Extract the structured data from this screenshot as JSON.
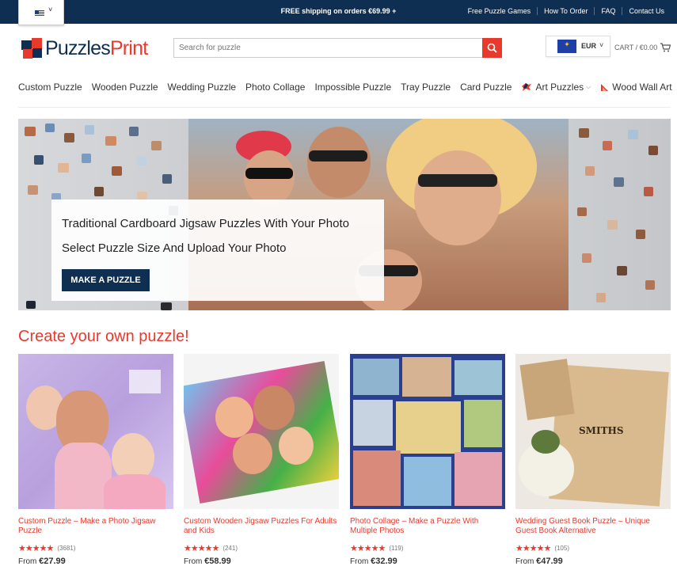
{
  "topbar": {
    "shipping": "FREE shipping on orders €69.99 +",
    "links": [
      "Free Puzzle Games",
      "How To Order",
      "FAQ",
      "Contact Us"
    ]
  },
  "language": {
    "icon": "us-flag-icon"
  },
  "logo": {
    "part1": "Puzzles",
    "part2": "Print"
  },
  "search": {
    "placeholder": "Search for puzzle"
  },
  "currency": {
    "label": "EUR"
  },
  "cart": {
    "label": "CART / €0.00"
  },
  "nav": [
    "Custom Puzzle",
    "Wooden Puzzle",
    "Wedding Puzzle",
    "Photo Collage",
    "Impossible Puzzle",
    "Tray Puzzle",
    "Card Puzzle",
    "Art Puzzles",
    "Wood Wall Art"
  ],
  "hero": {
    "line1": "Traditional Cardboard Jigsaw Puzzles With Your Photo",
    "line2": "Select Puzzle Size And Upload Your Photo",
    "button": "MAKE A PUZZLE"
  },
  "section_title": "Create your own puzzle!",
  "products": [
    {
      "title": "Custom Puzzle – Make a Photo Jigsaw Puzzle",
      "stars": "★★★★★",
      "reviews": "(3681)",
      "price_prefix": "From",
      "price": "€27.99"
    },
    {
      "title": "Custom Wooden Jigsaw Puzzles For Adults and Kids",
      "stars": "★★★★★",
      "reviews": "(241)",
      "price_prefix": "From",
      "price": "€58.99"
    },
    {
      "title": "Photo Collage – Make a Puzzle With Multiple Photos",
      "stars": "★★★★★",
      "reviews": "(119)",
      "price_prefix": "From",
      "price": "€32.99"
    },
    {
      "title": "Wedding Guest Book Puzzle – Unique Guest Book Alternative",
      "stars": "★★★★★",
      "reviews": "(105)",
      "price_prefix": "From",
      "price": "€47.99"
    }
  ],
  "wood_sign": {
    "line1": "SMITHS"
  },
  "colors": {
    "navy": "#0f2f52",
    "accent": "#e8392d"
  }
}
